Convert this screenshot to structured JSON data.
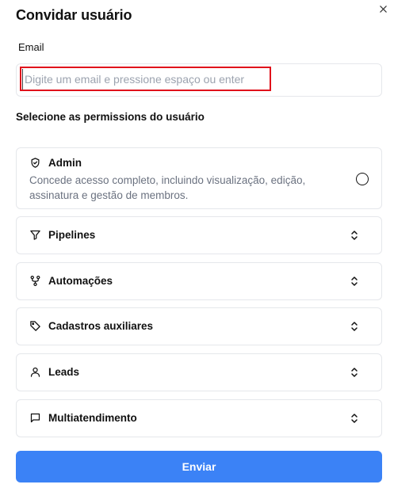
{
  "dialog": {
    "title": "Convidar usuário",
    "close_icon": "close-icon"
  },
  "email": {
    "label": "Email",
    "value": "",
    "placeholder": "Digite um email e pressione espaço ou enter",
    "highlight_color": "#e0111b"
  },
  "permissions": {
    "title": "Selecione as permissions do usuário",
    "admin": {
      "label": "Admin",
      "description": "Concede acesso completo, incluindo visualização, edição, assinatura e gestão de membros.",
      "icon": "shield-check-icon",
      "selected": false
    },
    "items": [
      {
        "label": "Pipelines",
        "icon": "filter-icon"
      },
      {
        "label": "Automações",
        "icon": "workflow-icon"
      },
      {
        "label": "Cadastros auxiliares",
        "icon": "tag-icon"
      },
      {
        "label": "Leads",
        "icon": "user-icon"
      },
      {
        "label": "Multiatendimento",
        "icon": "message-square-icon"
      }
    ]
  },
  "submit": {
    "label": "Enviar",
    "color": "#3b82f6"
  }
}
